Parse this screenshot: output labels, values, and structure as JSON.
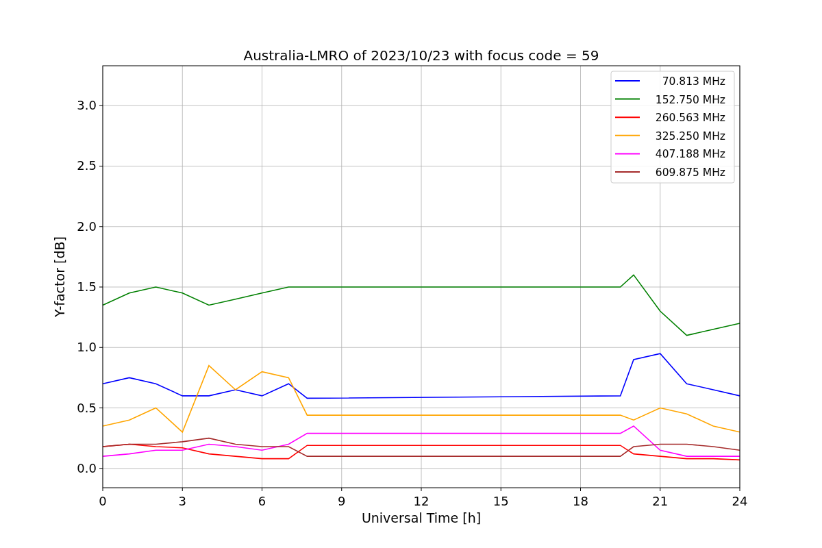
{
  "figure": {
    "chart_data": {
      "type": "line",
      "title": "Australia-LMRO of 2023/10/23 with focus code = 59",
      "xlabel": "Universal Time [h]",
      "ylabel": "Y-factor [dB]",
      "x": [
        0,
        1,
        2,
        3,
        4,
        5,
        6,
        7,
        7.7,
        19.5,
        20,
        21,
        22,
        23,
        24
      ],
      "grid": true,
      "legend": true,
      "xlim": [
        0,
        24
      ],
      "ylim": [
        -0.16,
        3.33
      ],
      "xticks": [
        0,
        3,
        6,
        9,
        12,
        15,
        18,
        21,
        24
      ],
      "yticks": [
        {
          "value": 0,
          "label": "0.0"
        },
        {
          "value": 0.5,
          "label": "0.5"
        },
        {
          "value": 1,
          "label": "1.0"
        },
        {
          "value": 1.5,
          "label": "1.5"
        },
        {
          "value": 2,
          "label": "2.0"
        },
        {
          "value": 2.5,
          "label": "2.5"
        },
        {
          "value": 3,
          "label": "3.0"
        }
      ],
      "series": [
        {
          "name": "70.813 MHz",
          "color": "#0000ff",
          "values": [
            0.7,
            0.75,
            0.7,
            0.6,
            0.6,
            0.65,
            0.6,
            0.7,
            0.58,
            0.6,
            0.9,
            0.95,
            0.7,
            0.65,
            0.6
          ]
        },
        {
          "name": "152.750 MHz",
          "color": "#008000",
          "values": [
            1.35,
            1.45,
            1.5,
            1.45,
            1.35,
            1.4,
            1.45,
            1.5,
            1.5,
            1.5,
            1.6,
            1.3,
            1.1,
            1.15,
            1.2
          ]
        },
        {
          "name": "260.563 MHz",
          "color": "#ff0000",
          "values": [
            0.18,
            0.2,
            0.18,
            0.17,
            0.12,
            0.1,
            0.08,
            0.08,
            0.19,
            0.19,
            0.12,
            0.1,
            0.08,
            0.08,
            0.07
          ]
        },
        {
          "name": "325.250 MHz",
          "color": "#ffa500",
          "values": [
            0.35,
            0.4,
            0.5,
            0.3,
            0.85,
            0.65,
            0.8,
            0.75,
            0.44,
            0.44,
            0.4,
            0.5,
            0.45,
            0.35,
            0.3
          ]
        },
        {
          "name": "407.188 MHz",
          "color": "#ff00ff",
          "values": [
            0.1,
            0.12,
            0.15,
            0.15,
            0.2,
            0.18,
            0.15,
            0.2,
            0.29,
            0.29,
            0.35,
            0.15,
            0.1,
            0.1,
            0.1
          ]
        },
        {
          "name": "609.875 MHz",
          "color": "#a52a2a",
          "values": [
            0.18,
            0.2,
            0.2,
            0.22,
            0.25,
            0.2,
            0.18,
            0.18,
            0.1,
            0.1,
            0.18,
            0.2,
            0.2,
            0.18,
            0.15
          ]
        }
      ]
    }
  }
}
